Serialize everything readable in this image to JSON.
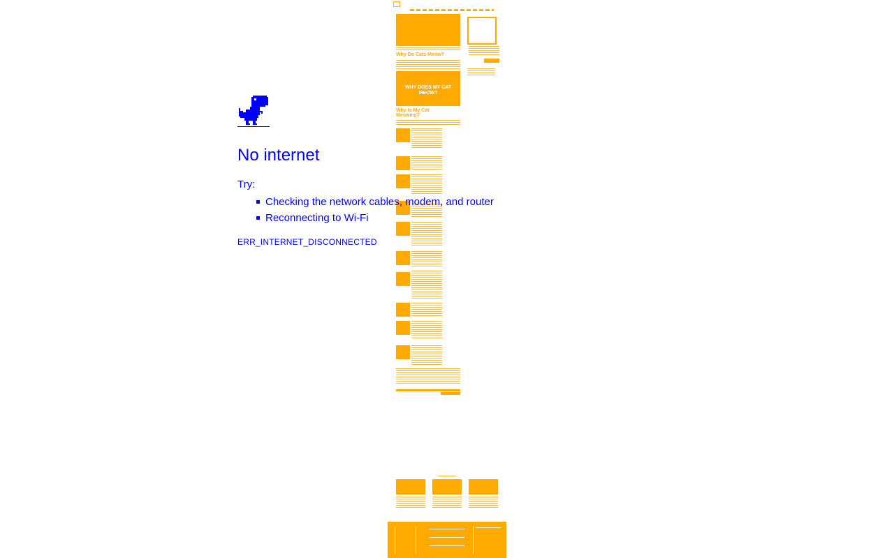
{
  "error_page": {
    "icon": "dino-icon",
    "title": "No internet",
    "try_label": "Try:",
    "suggestions": [
      "Checking the network cables, modem, and router",
      "Reconnecting to Wi-Fi"
    ],
    "error_code": "ERR_INTERNET_DISCONNECTED"
  },
  "background_page": {
    "overlay_caption": "WHY DOES MY CAT MEOW?",
    "headings": [
      "Why Do Cats Meow?",
      "Why Is My Cat Meowing?"
    ]
  },
  "colors": {
    "foreground_text": "#0000ff",
    "background_page": "#ffaa00",
    "page_background": "#ffffff"
  }
}
